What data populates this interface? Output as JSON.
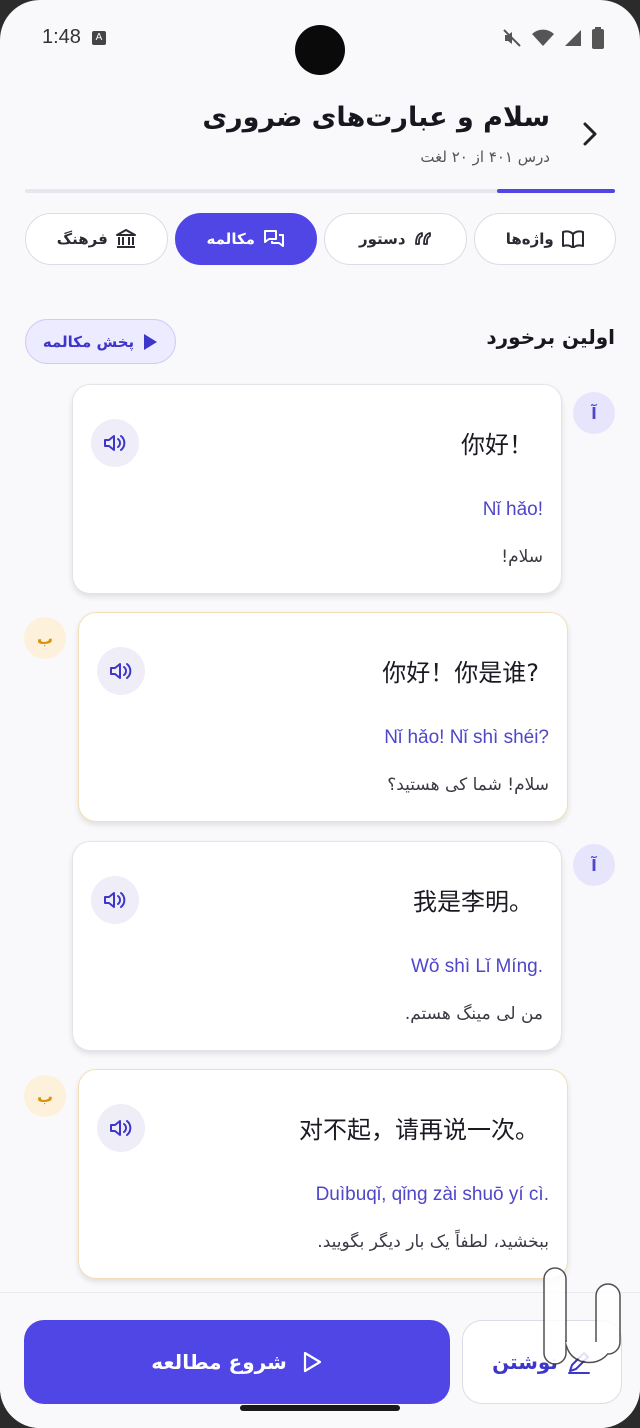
{
  "status_bar": {
    "time": "1:48",
    "notification_badge": "A"
  },
  "header": {
    "title": "سلام و عبارت‌های ضروری",
    "subtitle": "درس ۴۰۱ از ۲۰ لغت",
    "progress": 0.2
  },
  "tabs": [
    {
      "label": "واژه‌ها",
      "icon": "book-icon"
    },
    {
      "label": "دستور",
      "icon": "quote-icon"
    },
    {
      "label": "مکالمه",
      "icon": "chat-icon",
      "active": true
    },
    {
      "label": "فرهنگ",
      "icon": "museum-icon"
    }
  ],
  "section": {
    "title": "اولین برخورد",
    "play_label": "پخش مکالمه"
  },
  "messages": [
    {
      "speaker": "آ",
      "hanzi": "你好！",
      "pinyin": "Nǐ hǎo!",
      "translation": "سلام!"
    },
    {
      "speaker": "ب",
      "hanzi": "你好！你是谁?",
      "pinyin": "Nǐ hǎo! Nǐ shì shéi?",
      "translation": "سلام! شما کی هستید؟"
    },
    {
      "speaker": "آ",
      "hanzi": "我是李明。",
      "pinyin": "Wǒ shì Lǐ Míng.",
      "translation": "من لی مینگ هستم."
    },
    {
      "speaker": "ب",
      "hanzi": "对不起，请再说一次。",
      "pinyin": "Duìbuqǐ, qǐng zài shuō yí cì.",
      "translation": "ببخشید، لطفاً یک بار دیگر بگویید."
    }
  ],
  "bottom": {
    "start_label": "شروع مطالعه",
    "write_label": "نوشتن"
  },
  "colors": {
    "accent": "#4f46e5",
    "speaker_a": "#e7e5fb",
    "speaker_b": "#fdf1dc"
  }
}
